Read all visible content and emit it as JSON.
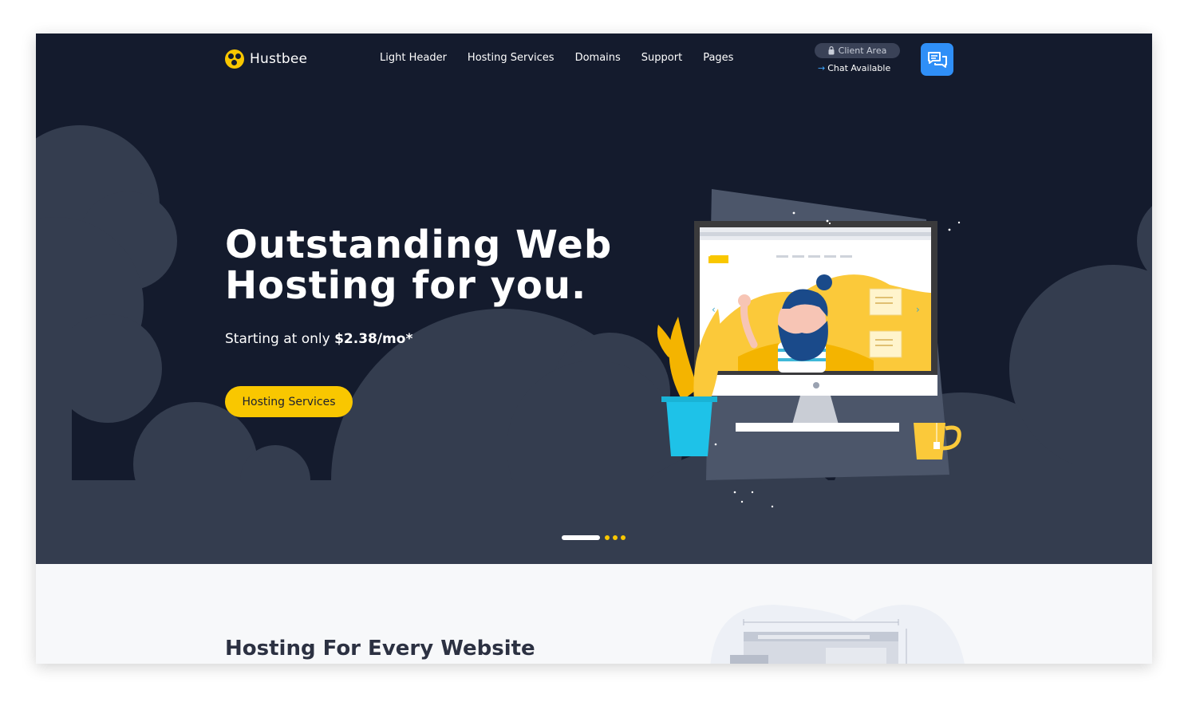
{
  "header": {
    "logo_text": "Hustbee",
    "nav": [
      "Light Header",
      "Hosting Services",
      "Domains",
      "Support",
      "Pages"
    ],
    "client_area_label": "Client Area",
    "chat_status": "Chat Available"
  },
  "hero": {
    "title_line1": "Outstanding Web",
    "title_line2": "Hosting for you.",
    "subtitle_prefix": "Starting at only ",
    "price": "$2.38/mo*",
    "cta_label": "Hosting Services",
    "slides_total": 4,
    "active_slide": 1
  },
  "section": {
    "title": "Hosting For Every Website"
  },
  "colors": {
    "hero_bg": "#141b2d",
    "cloud": "#343d4f",
    "accent_yellow": "#f9c700",
    "chat_blue": "#2f8ff7",
    "page_bg": "#f7f8fa"
  },
  "icons": [
    "logo-icon",
    "lock-icon",
    "arrow-right-icon",
    "chat-bubbles-icon"
  ]
}
